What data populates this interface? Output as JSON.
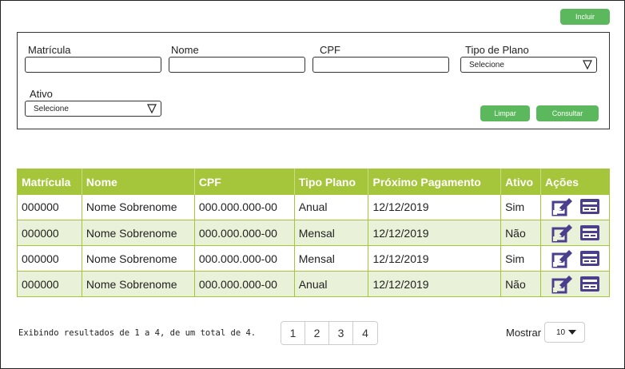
{
  "toolbar": {
    "incluir_label": "Incluir"
  },
  "filters": {
    "matricula_label": "Matrícula",
    "nome_label": "Nome",
    "cpf_label": "CPF",
    "tipo_plano_label": "Tipo de Plano",
    "tipo_plano_value": "Selecione",
    "ativo_label": "Ativo",
    "ativo_value": "Selecione",
    "limpar_label": "Limpar",
    "consultar_label": "Consultar"
  },
  "table": {
    "columns": [
      "Matrícula",
      "Nome",
      "CPF",
      "Tipo Plano",
      "Próximo Pagamento",
      "Ativo",
      "Ações"
    ],
    "rows": [
      {
        "matricula": "000000",
        "nome": "Nome Sobrenome",
        "cpf": "000.000.000-00",
        "tipo_plano": "Anual",
        "proximo_pagamento": "12/12/2019",
        "ativo": "Sim"
      },
      {
        "matricula": "000000",
        "nome": "Nome Sobrenome",
        "cpf": "000.000.000-00",
        "tipo_plano": "Mensal",
        "proximo_pagamento": "12/12/2019",
        "ativo": "Não"
      },
      {
        "matricula": "000000",
        "nome": "Nome Sobrenome",
        "cpf": "000.000.000-00",
        "tipo_plano": "Mensal",
        "proximo_pagamento": "12/12/2019",
        "ativo": "Sim"
      },
      {
        "matricula": "000000",
        "nome": "Nome Sobrenome",
        "cpf": "000.000.000-00",
        "tipo_plano": "Anual",
        "proximo_pagamento": "12/12/2019",
        "ativo": "Não"
      }
    ],
    "action_icons": [
      "edit-icon",
      "card-icon"
    ]
  },
  "footer": {
    "summary": "Exibindo resultados de 1 a 4, de um total de 4.",
    "pages": [
      "1",
      "2",
      "3",
      "4"
    ],
    "mostrar_label": "Mostrar",
    "mostrar_value": "10"
  },
  "colors": {
    "accent_green": "#5cb85c",
    "header_green": "#a5c63b",
    "row_alt": "#e9f1d9",
    "icon_purple": "#4a3f8c"
  }
}
